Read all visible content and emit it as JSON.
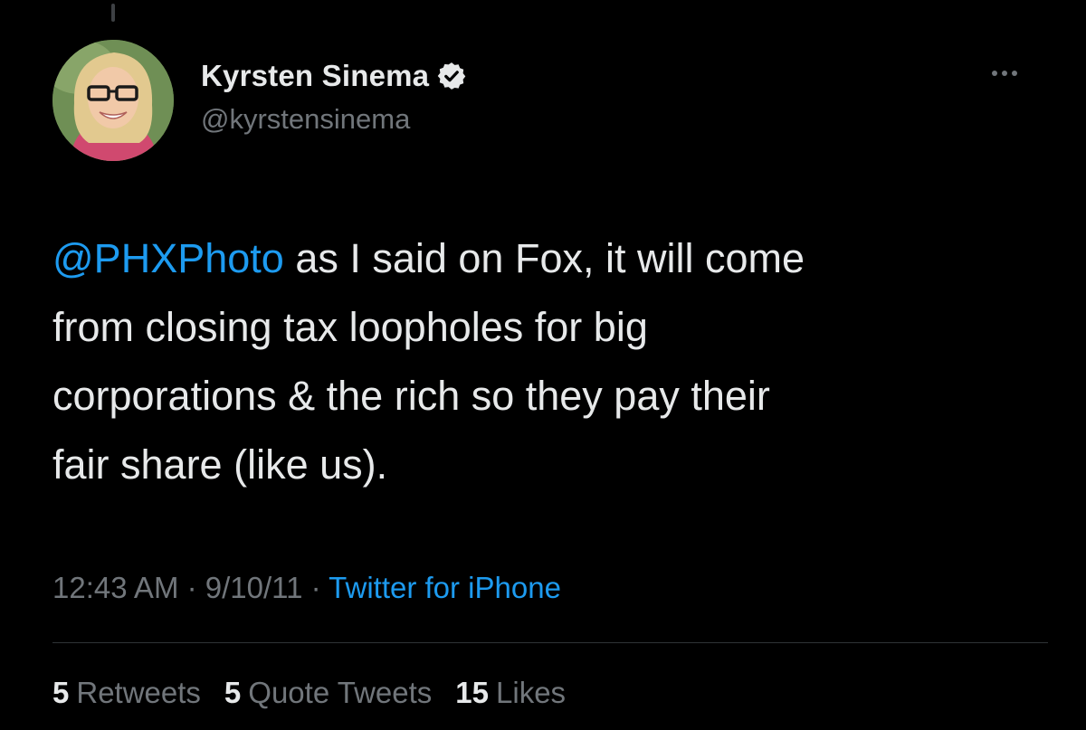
{
  "author": {
    "display_name": "Kyrsten Sinema",
    "handle": "@kyrstensinema",
    "verified": true
  },
  "tweet": {
    "mention": "@PHXPhoto",
    "text_line1": " as I said on Fox, it will come",
    "text_line2": "from closing tax loopholes for big",
    "text_line3": "corporations & the rich so they pay their",
    "text_line4": "fair share (like us)."
  },
  "meta": {
    "time": "12:43 AM",
    "separator": " · ",
    "date": "9/10/11",
    "source": "Twitter for iPhone"
  },
  "stats": {
    "retweets_count": "5",
    "retweets_label": "Retweets",
    "quotes_count": "5",
    "quotes_label": "Quote Tweets",
    "likes_count": "15",
    "likes_label": "Likes"
  },
  "icons": {
    "verified": "verified-badge-icon",
    "more": "more-options-icon"
  },
  "colors": {
    "background": "#000000",
    "text": "#e7e9ea",
    "secondary": "#71767b",
    "accent": "#1d9bf0"
  }
}
